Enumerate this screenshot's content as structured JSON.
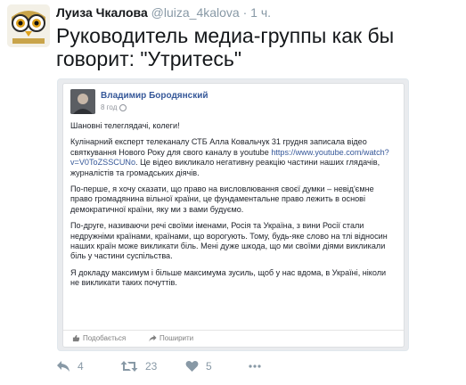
{
  "tweet": {
    "author_name": "Луиза Чкалова",
    "author_handle": "@luiza_4kalova",
    "separator": "·",
    "time": "1 ч.",
    "text": "Руководитель медиа-группы как бы говорит: \"Утритесь\""
  },
  "card": {
    "fb_author": "Владимир Бородянский",
    "fb_time": "8 год",
    "paragraphs": [
      "Шановні телеглядачі, колеги!",
      "Кулінарний експерт телеканалу СТБ Алла Ковальчук 31 грудня записала відео святкування Нового Року для свого каналу в youtube",
      "По-перше, я хочу сказати, що право на висловлювання своєї думки – невід'ємне право громадянина вільної країни, це фундаментальне право лежить в основі демократичної країни, яку ми з вами будуємо.",
      "По-друге, називаючи речі своїми іменами, Росія та Україна, з вини Росії стали недружніми країнами, країнами, що ворогують. Тому, будь-яке слово на тлі відносин наших країн може викликати біль. Мені дуже шкода, що ми своїми діями викликали біль у частини суспільства.",
      "Я докладу максимум і більше максимума зусиль, щоб у нас вдома, в Україні, ніколи не викликати таких почуттів."
    ],
    "link": "https://www.youtube.com/watch?v=V0ToZSSCUNo",
    "after_link": ". Це відео викликало негативну реакцію частини наших глядачів, журналістів та громадських діячів.",
    "like_label": "Подобається",
    "share_label": "Поширити"
  },
  "actions": {
    "reply_count": "4",
    "retweet_count": "23",
    "like_count": "5"
  },
  "icons": [
    "reply-icon",
    "retweet-icon",
    "heart-icon",
    "more-icon",
    "thumbs-up-icon",
    "share-icon"
  ],
  "colors": {
    "link": "#365899",
    "muted": "#8899a6",
    "text": "#14171a"
  }
}
